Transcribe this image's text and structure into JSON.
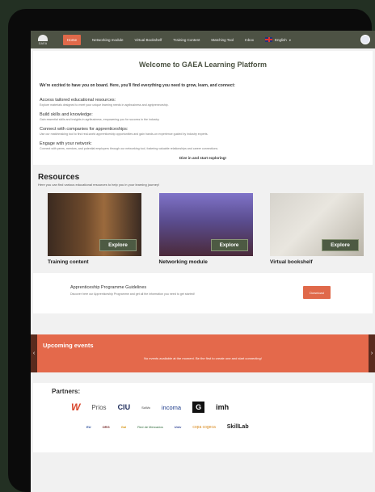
{
  "nav": {
    "logo_text": "GAEA",
    "items": [
      "Home",
      "Networking module",
      "Virtual Bookshelf",
      "Training Content",
      "Matching Tool",
      "Inbox"
    ],
    "language": "English"
  },
  "welcome": {
    "title": "Welcome to GAEA Learning Platform",
    "intro": "We're excited to have you on board. Here, you'll find everything you need to grow, learn, and connect:",
    "sections": [
      {
        "heading": "Access tailored educational resources:",
        "desc": "Explore materials designed to meet your unique learning needs in agribusiness and agripreneurship."
      },
      {
        "heading": "Build skills and knowledge:",
        "desc": "Gain essential skills and insights in agribusiness, empowering you for success in the industry."
      },
      {
        "heading": "Connect with companies for apprenticeships:",
        "desc": "Use our matchmaking tool to find real-world apprenticeship opportunities and gain hands-on experience guided by industry experts."
      },
      {
        "heading": "Engage with your network:",
        "desc": "Connect with peers, mentors, and potential employers through our networking tool, fostering valuable relationships and career connections."
      }
    ],
    "cta": "Dive in and start exploring!"
  },
  "resources": {
    "title": "Resources",
    "subtitle": "Here you can find various educational resources to help you in your learning journey!",
    "cards": [
      {
        "label": "Training content",
        "button": "Explore"
      },
      {
        "label": "Networking module",
        "button": "Explore"
      },
      {
        "label": "Virtual bookshelf",
        "button": "Explore"
      }
    ]
  },
  "guidelines": {
    "title": "Apprenticeship Programme Guidelines",
    "desc": "Discover here our Apprenticeship Programme and get all the information you need to get started!",
    "button": "Download"
  },
  "events": {
    "title": "Upcoming events",
    "message": "No events available at the moment. Be the first to create one and start connecting!",
    "prev": "‹",
    "next": "›"
  },
  "partners": {
    "title": "Partners:",
    "row1": [
      "W",
      "Prios",
      "CIU",
      "SoWo",
      "incoma",
      "G",
      "imh"
    ],
    "row2": [
      "EU",
      "ORG",
      "Gal",
      "Red de Mercados",
      "Univ",
      "copa cogeca",
      "SkillLab"
    ]
  },
  "colors": {
    "accent": "#e0694a",
    "nav_bg": "#4d5244",
    "button_green": "#4d5a43",
    "background": "#233023"
  }
}
